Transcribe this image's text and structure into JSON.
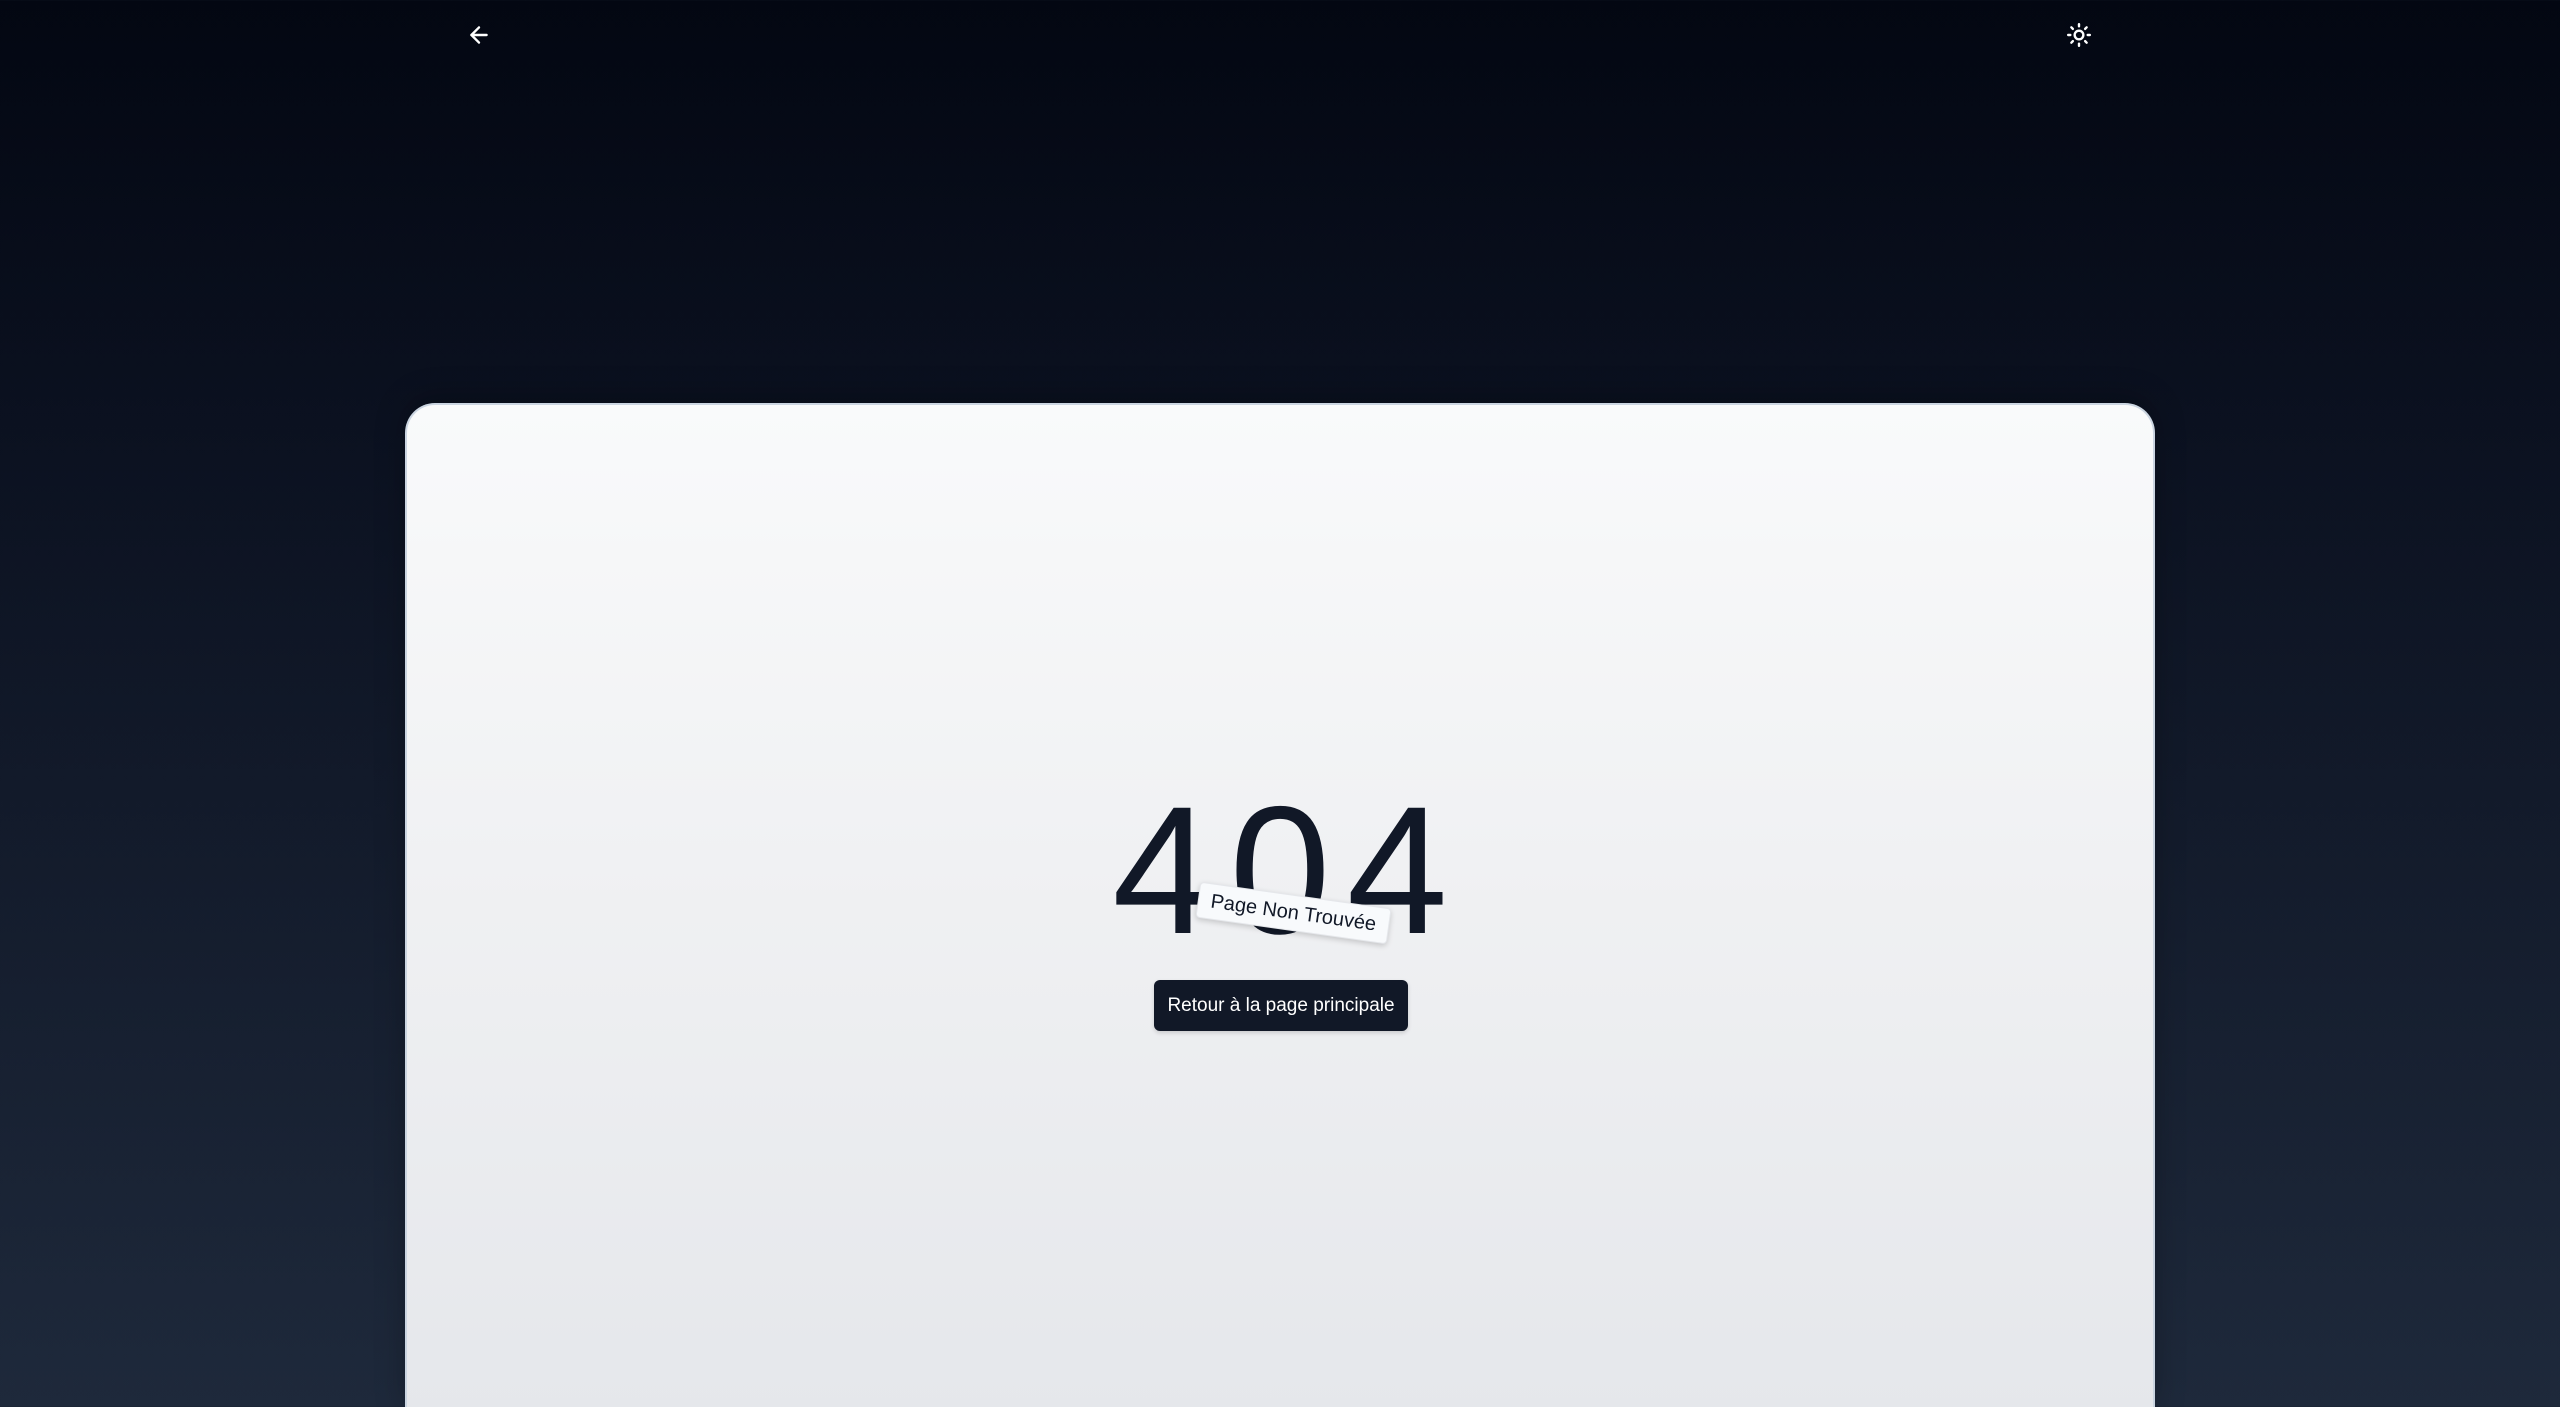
{
  "header": {
    "back_icon": "arrow-left-icon",
    "theme_icon": "sun-icon"
  },
  "error": {
    "code": "404",
    "tag": "Page Non Trouvée",
    "home_button_label": "Retour à la page principale"
  },
  "colors": {
    "background_top": "#030712",
    "background_bottom": "#1e293b",
    "card": "#f3f4f6",
    "text": "#111827",
    "button": "#111827",
    "button_text": "#ffffff"
  }
}
